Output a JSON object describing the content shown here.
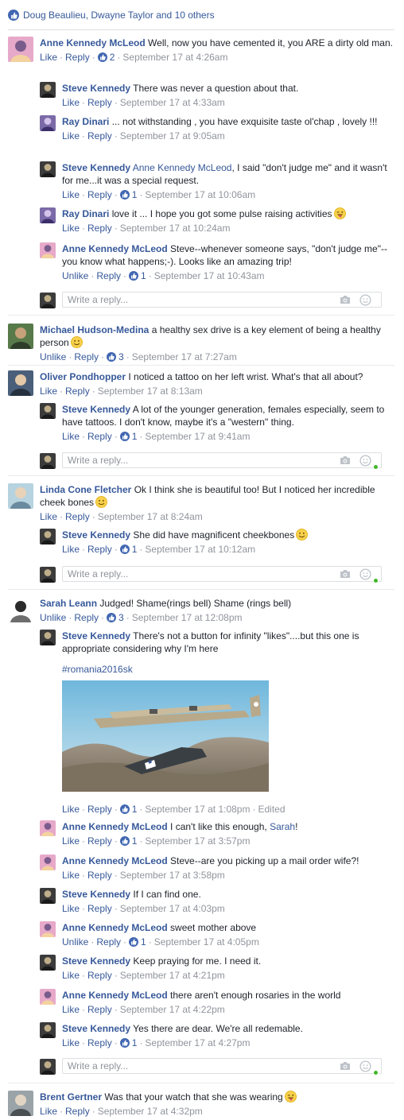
{
  "likers": "Doug Beaulieu, Dwayne Taylor and 10 others",
  "reply_placeholder": "Write a reply...",
  "actions": {
    "like": "Like",
    "unlike": "Unlike",
    "reply": "Reply",
    "sep": "·",
    "edited": "Edited"
  },
  "colors": {
    "link": "#365899",
    "meta": "#90949c",
    "like_blue": "#4267b2",
    "online": "#42b72a"
  },
  "comments": [
    {
      "name": "Anne Kennedy McLeod",
      "text": "Well, now you have cemented it, you ARE a dirty old man.",
      "like": "Like",
      "likes": "2",
      "time": "September 17 at 4:26am"
    },
    {
      "name": "Steve Kennedy",
      "text": "There was never a question about that.",
      "like": "Like",
      "time": "September 17 at 4:33am"
    },
    {
      "name": "Ray Dinari",
      "text": "... not withstanding , you have exquisite taste ol'chap , lovely !!!",
      "like": "Like",
      "time": "September 17 at 9:05am"
    },
    {
      "name": "Steve Kennedy",
      "mention": "Anne Kennedy McLeod",
      "text": ", I said \"don't judge me\" and it wasn't for me...it was a special request.",
      "like": "Like",
      "likes": "1",
      "time": "September 17 at 10:06am"
    },
    {
      "name": "Ray Dinari",
      "text": "love it ... I hope you got some pulse raising activities",
      "emoji": "tongue-wink-emoji",
      "like": "Like",
      "time": "September 17 at 10:24am"
    },
    {
      "name": "Anne Kennedy McLeod",
      "text": "Steve--whenever someone says, \"don't judge me\"--you know what happens;-). Looks like an amazing trip!",
      "like": "Unlike",
      "likes": "1",
      "time": "September 17 at 10:43am"
    },
    {
      "name": "Michael Hudson-Medina",
      "text": "a healthy sex drive is a key element of being a healthy person",
      "emoji": "smile-emoji",
      "like": "Unlike",
      "likes": "3",
      "time": "September 17 at 7:27am"
    },
    {
      "name": "Oliver Pondhopper",
      "text": "I noticed a tattoo on her left wrist. What's that all about?",
      "like": "Like",
      "time": "September 17 at 8:13am"
    },
    {
      "name": "Steve Kennedy",
      "text": "A lot of the younger generation, females especially, seem to have tattoos. I don't know, maybe it's a \"western\" thing.",
      "like": "Like",
      "likes": "1",
      "time": "September 17 at 9:41am"
    },
    {
      "name": "Linda Cone Fletcher",
      "text": "Ok I think she is beautiful too! But I noticed her incredible cheek bones",
      "emoji": "smile-emoji",
      "like": "Like",
      "time": "September 17 at 8:24am"
    },
    {
      "name": "Steve Kennedy",
      "text": "She did have magnificent cheekbones",
      "emoji": "smile-emoji",
      "like": "Like",
      "likes": "1",
      "time": "September 17 at 10:12am"
    },
    {
      "name": "Sarah Leann",
      "text": "Judged! Shame(rings bell) Shame (rings bell)",
      "like": "Unlike",
      "likes": "3",
      "time": "September 17 at 12:08pm"
    },
    {
      "name": "Steve Kennedy",
      "text": "There's not a button for infinity \"likes\"....but this one is appropriate considering why I'm here",
      "hashtag": "#romania2016sk",
      "like": "Like",
      "likes": "1",
      "time": "September 17 at 1:08pm",
      "edited": true
    },
    {
      "name": "Anne Kennedy McLeod",
      "text": "I can't like this enough, ",
      "mention_after": "Sarah",
      "text_end": "!",
      "like": "Like",
      "likes": "1",
      "time": "September 17 at 3:57pm"
    },
    {
      "name": "Anne Kennedy McLeod",
      "text": "Steve--are you picking up a mail order wife?!",
      "like": "Like",
      "time": "September 17 at 3:58pm"
    },
    {
      "name": "Steve Kennedy",
      "text": "If I can find one.",
      "like": "Like",
      "time": "September 17 at 4:03pm"
    },
    {
      "name": "Anne Kennedy McLeod",
      "text": "sweet mother above",
      "like": "Unlike",
      "likes": "1",
      "time": "September 17 at 4:05pm"
    },
    {
      "name": "Steve Kennedy",
      "text": "Keep praying for me. I need it.",
      "like": "Like",
      "time": "September 17 at 4:21pm"
    },
    {
      "name": "Anne Kennedy McLeod",
      "text": "there aren't enough rosaries in the world",
      "like": "Like",
      "time": "September 17 at 4:22pm"
    },
    {
      "name": "Steve Kennedy",
      "text": "Yes there are dear. We're all redemable.",
      "like": "Like",
      "likes": "1",
      "time": "September 17 at 4:27pm"
    },
    {
      "name": "Brent Gertner",
      "text": "Was that your watch that she was wearing",
      "emoji": "tongue-wink-emoji",
      "like": "Like",
      "time": "September 17 at 4:32pm"
    }
  ]
}
